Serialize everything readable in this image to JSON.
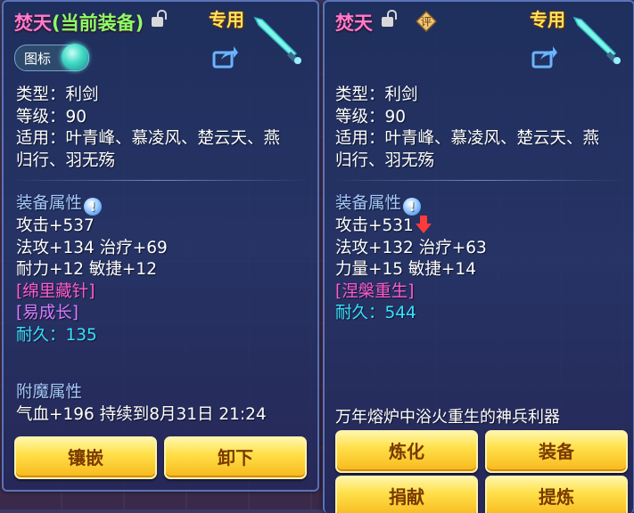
{
  "left_panel": {
    "item_name": "焚天",
    "equipped_tag": "(当前装备)",
    "exclusive_label": "专用",
    "icon_toggle_label": "图标",
    "type_line": "类型：利剑",
    "level_line": "等级：90",
    "applicable_line1": "适用：叶青峰、慕凌风、楚云天、燕",
    "applicable_line2": "归行、羽无殇",
    "attr_section": "装备属性",
    "attack": "攻击+537",
    "stats_line2": "法攻+134 治疗+69",
    "stats_line3": "耐力+12 敏捷+12",
    "skill1": "[绵里藏针]",
    "skill2": "[易成长]",
    "durability": "耐久：135",
    "enchant_section": "附魔属性",
    "enchant_line": "气血+196 持续到8月31日 21:24",
    "btn_inlay": "镶嵌",
    "btn_unequip": "卸下"
  },
  "right_panel": {
    "item_name": "焚天",
    "rate_label": "评",
    "exclusive_label": "专用",
    "type_line": "类型：利剑",
    "level_line": "等级：90",
    "applicable_line1": "适用：叶青峰、慕凌风、楚云天、燕",
    "applicable_line2": "归行、羽无殇",
    "attr_section": "装备属性",
    "attack": "攻击+531",
    "stats_line2": "法攻+132 治疗+63",
    "stats_line3": "力量+15 敏捷+14",
    "skill1": "[涅槃重生]",
    "durability": "耐久：544",
    "description": "万年熔炉中浴火重生的神兵利器",
    "btn_refine": "炼化",
    "btn_equip": "装备",
    "btn_donate": "捐献",
    "btn_extract": "提炼"
  },
  "colors": {
    "title_pink": "#ff7ad1",
    "equipped_green": "#8cff6a",
    "exclusive_gold": "#ffe35a",
    "section_blue": "#a4c8ff",
    "durability_cyan": "#39e0ff",
    "button_gold": "#ffe04a"
  }
}
